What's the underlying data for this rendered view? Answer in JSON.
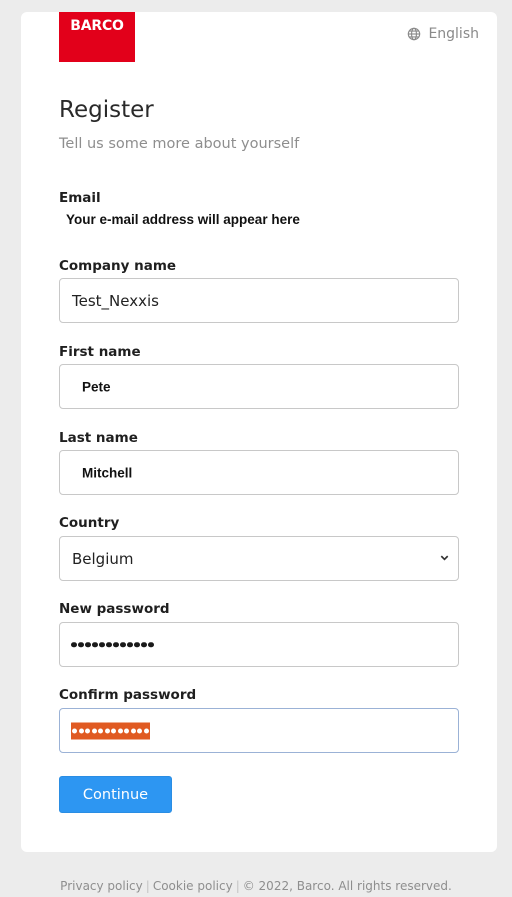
{
  "brand": {
    "logo_text": "BARCO",
    "logo_color": "#e2001a"
  },
  "language": {
    "icon": "globe-icon",
    "label": "English"
  },
  "header": {
    "title": "Register",
    "subtitle": "Tell us some more about yourself"
  },
  "form": {
    "email": {
      "label": "Email",
      "value": "Your e-mail address will appear here"
    },
    "company": {
      "label": "Company name",
      "value": "Test_Nexxis"
    },
    "first_name": {
      "label": "First name",
      "value": "Pete"
    },
    "last_name": {
      "label": "Last name",
      "value": "Mitchell"
    },
    "country": {
      "label": "Country",
      "value": "Belgium",
      "icon": "chevron-down-icon"
    },
    "new_password": {
      "label": "New password",
      "masked_length": 12
    },
    "confirm_password": {
      "label": "Confirm password",
      "masked_length": 12,
      "selection_color": "#e05a22"
    }
  },
  "actions": {
    "continue_label": "Continue",
    "accent": "#2d96f2"
  },
  "footer": {
    "privacy": "Privacy policy",
    "cookie": "Cookie policy",
    "separator": "|",
    "copyright": "© 2022, Barco. All rights reserved."
  }
}
